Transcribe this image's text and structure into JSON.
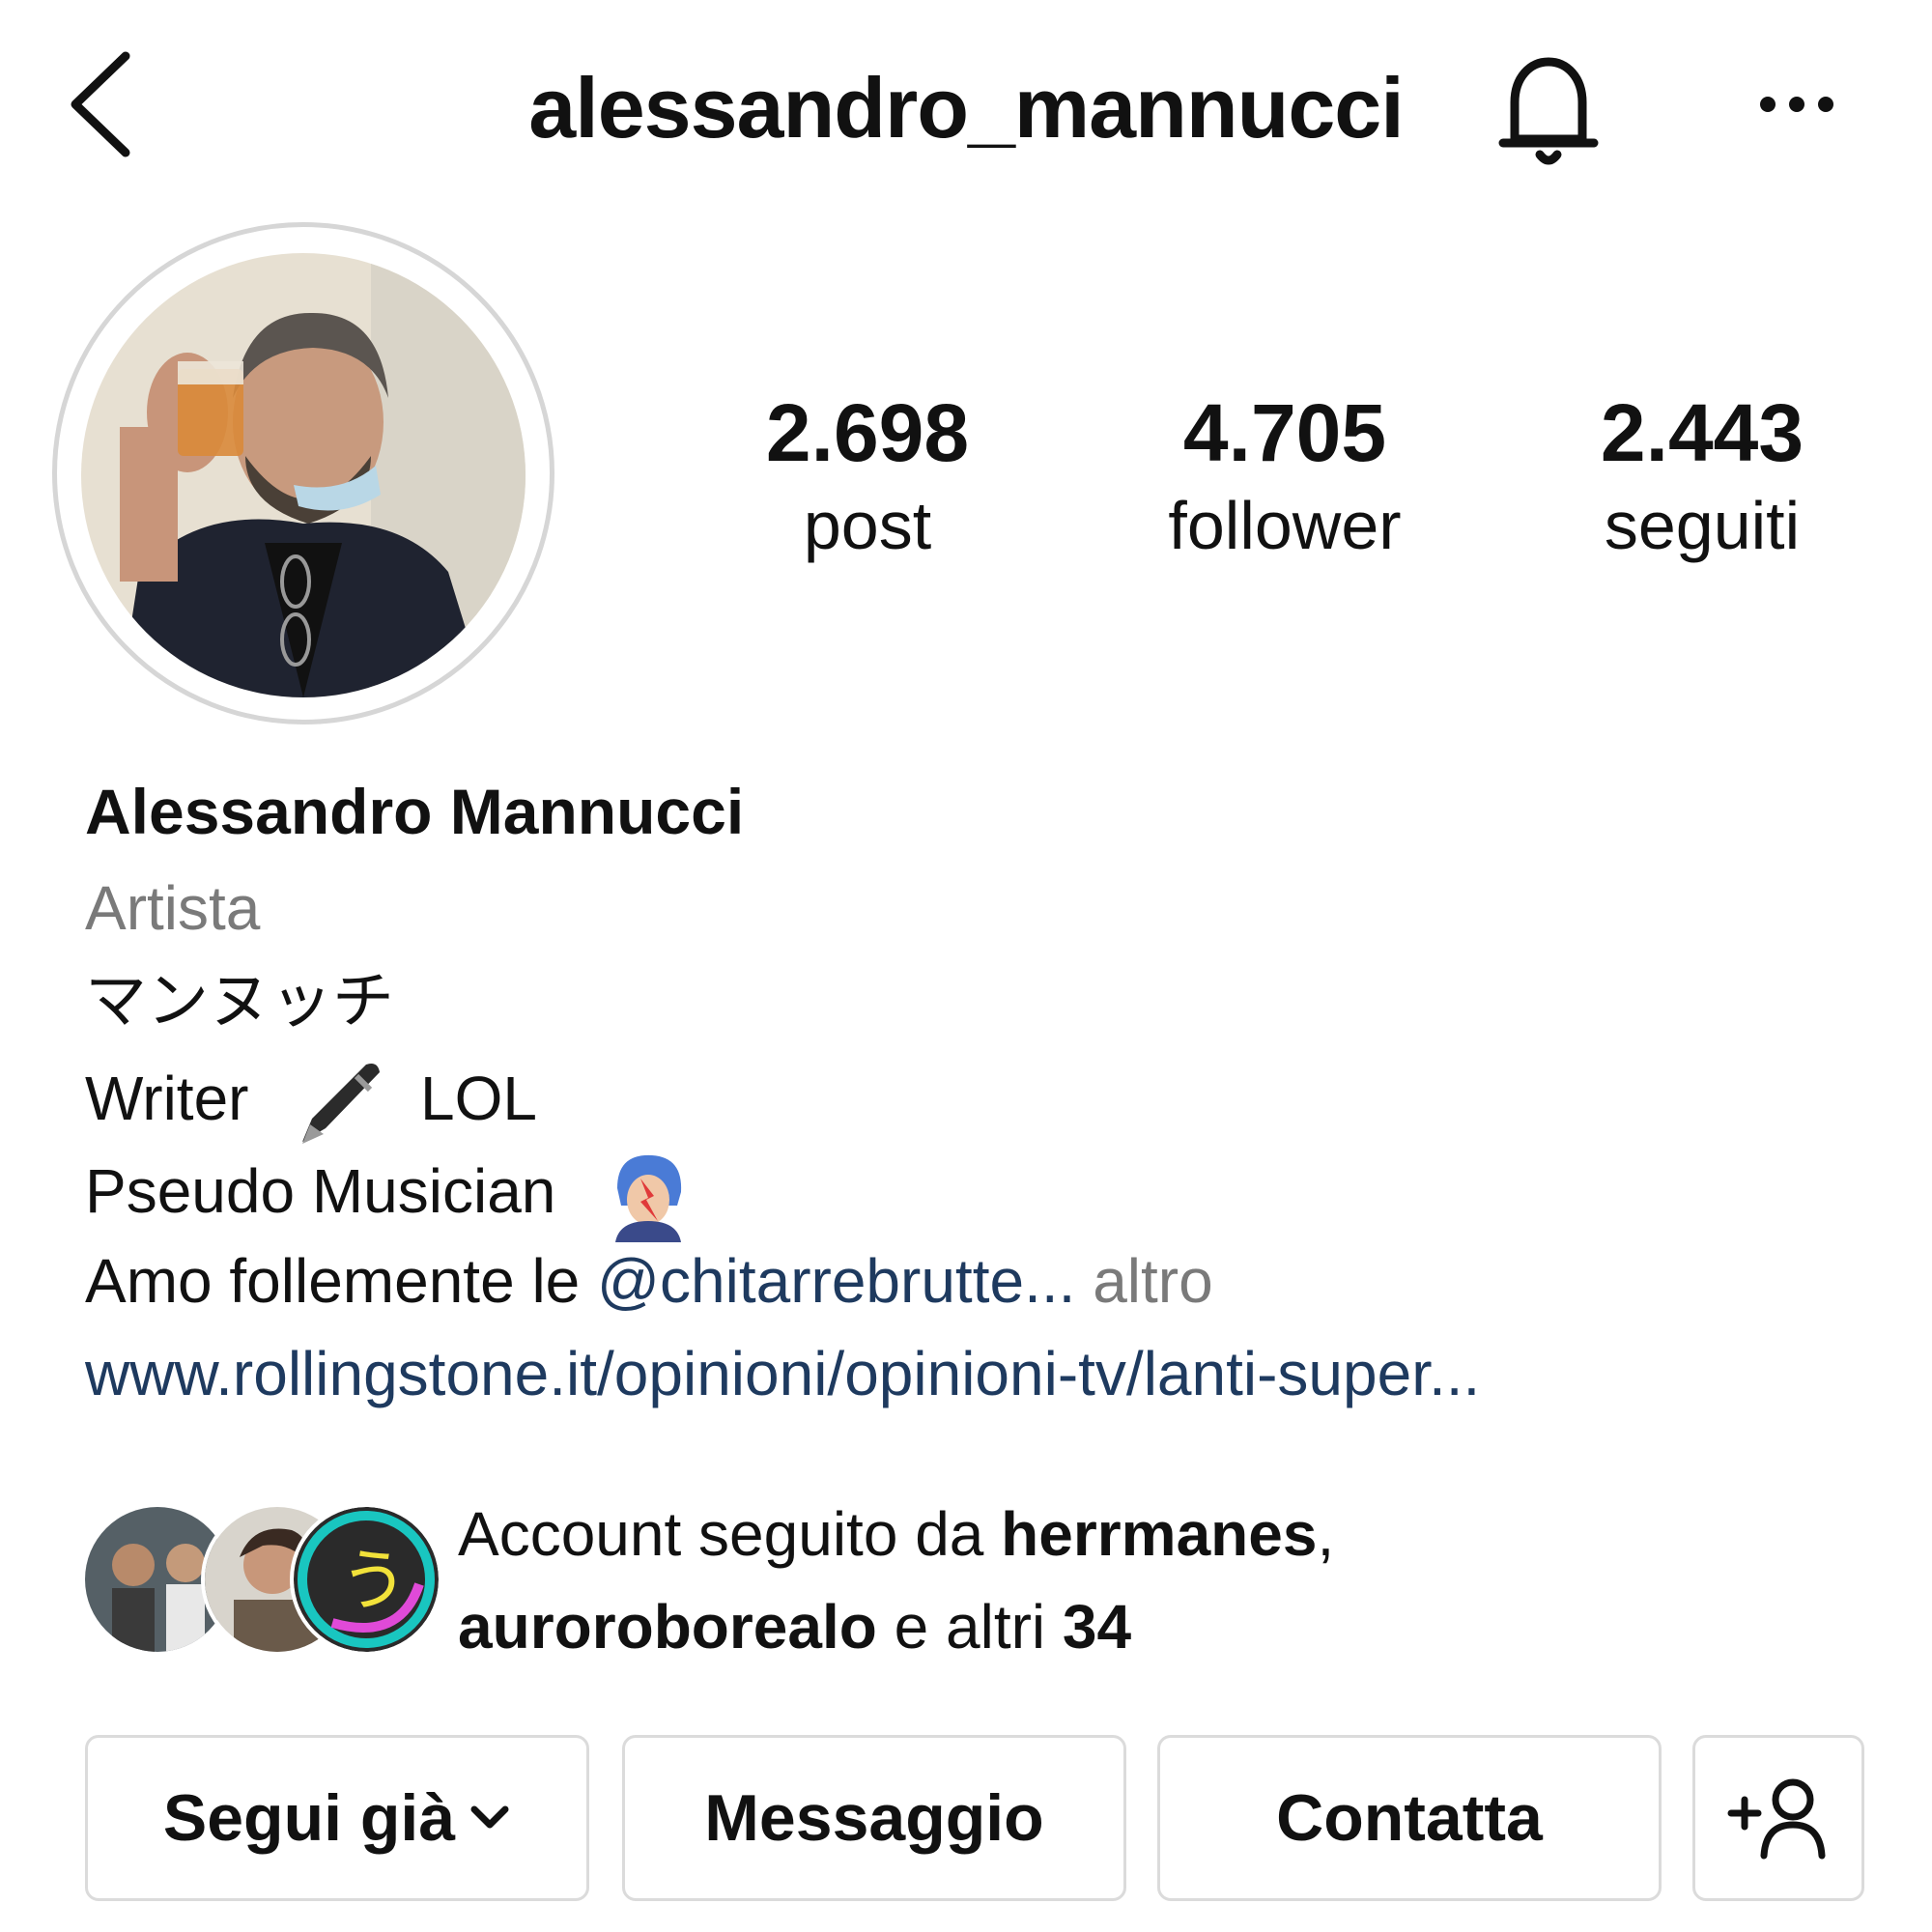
{
  "header": {
    "username": "alessandro_mannucci",
    "back_icon": "chevron-left-icon",
    "bell_icon": "bell-icon",
    "more_icon": "more-horizontal-icon"
  },
  "stats": [
    {
      "value": "2.698",
      "label": "post"
    },
    {
      "value": "4.705",
      "label": "follower"
    },
    {
      "value": "2.443",
      "label": "seguiti"
    }
  ],
  "bio": {
    "name": "Alessandro Mannucci",
    "category": "Artista",
    "line_jp": "マンヌッチ",
    "line_writer_a": "Writer",
    "line_writer_b": "LOL",
    "line_music": "Pseudo Musician",
    "line_amo_prefix": "Amo follemente le ",
    "line_amo_mention": "@chitarrebrutte...",
    "line_amo_more": "altro",
    "link": "www.rollingstone.it/opinioni/opinioni-tv/lanti-super..."
  },
  "followed_by": {
    "prefix": "Account seguito da ",
    "user1": "herrmanes",
    "comma": ",",
    "user2": "aurorobore­alo",
    "user2_plain": "auroroborealo",
    "middle": " e altri ",
    "count": "34"
  },
  "actions": {
    "follow": "Segui già",
    "message": "Messaggio",
    "contact": "Contatta",
    "add_user_icon": "add-user-icon"
  },
  "colors": {
    "link": "#1e3a5f",
    "muted": "#7a7a7a",
    "border": "#dbdbdb"
  }
}
